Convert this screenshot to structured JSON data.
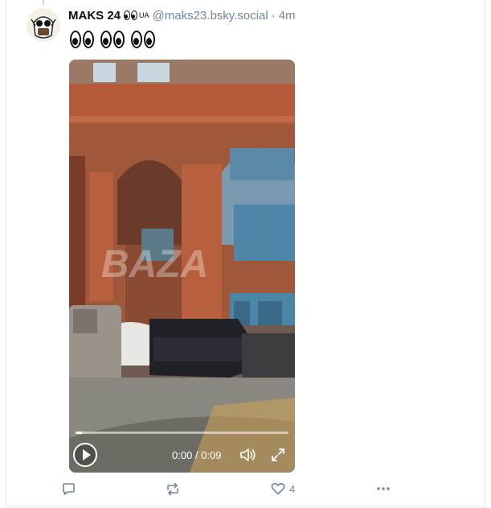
{
  "post": {
    "author_name": "MAKS 24",
    "author_badge": "UA",
    "handle": "@maks23.bsky.social",
    "separator": "·",
    "time": "4m",
    "text_emoji": "eyes-emoji x3"
  },
  "video": {
    "current_time": "0:00",
    "duration": "0:09",
    "time_display": "0:00 / 0:09",
    "progress_fraction": 0.03,
    "watermark": "BAZA"
  },
  "actions": {
    "reply_icon": "reply-icon",
    "repost_icon": "repost-icon",
    "like_icon": "heart-icon",
    "like_count": "4",
    "more_icon": "more-icon"
  },
  "colors": {
    "muted": "#6f869f",
    "text": "#0b0f14",
    "border": "#e6e9ec"
  }
}
